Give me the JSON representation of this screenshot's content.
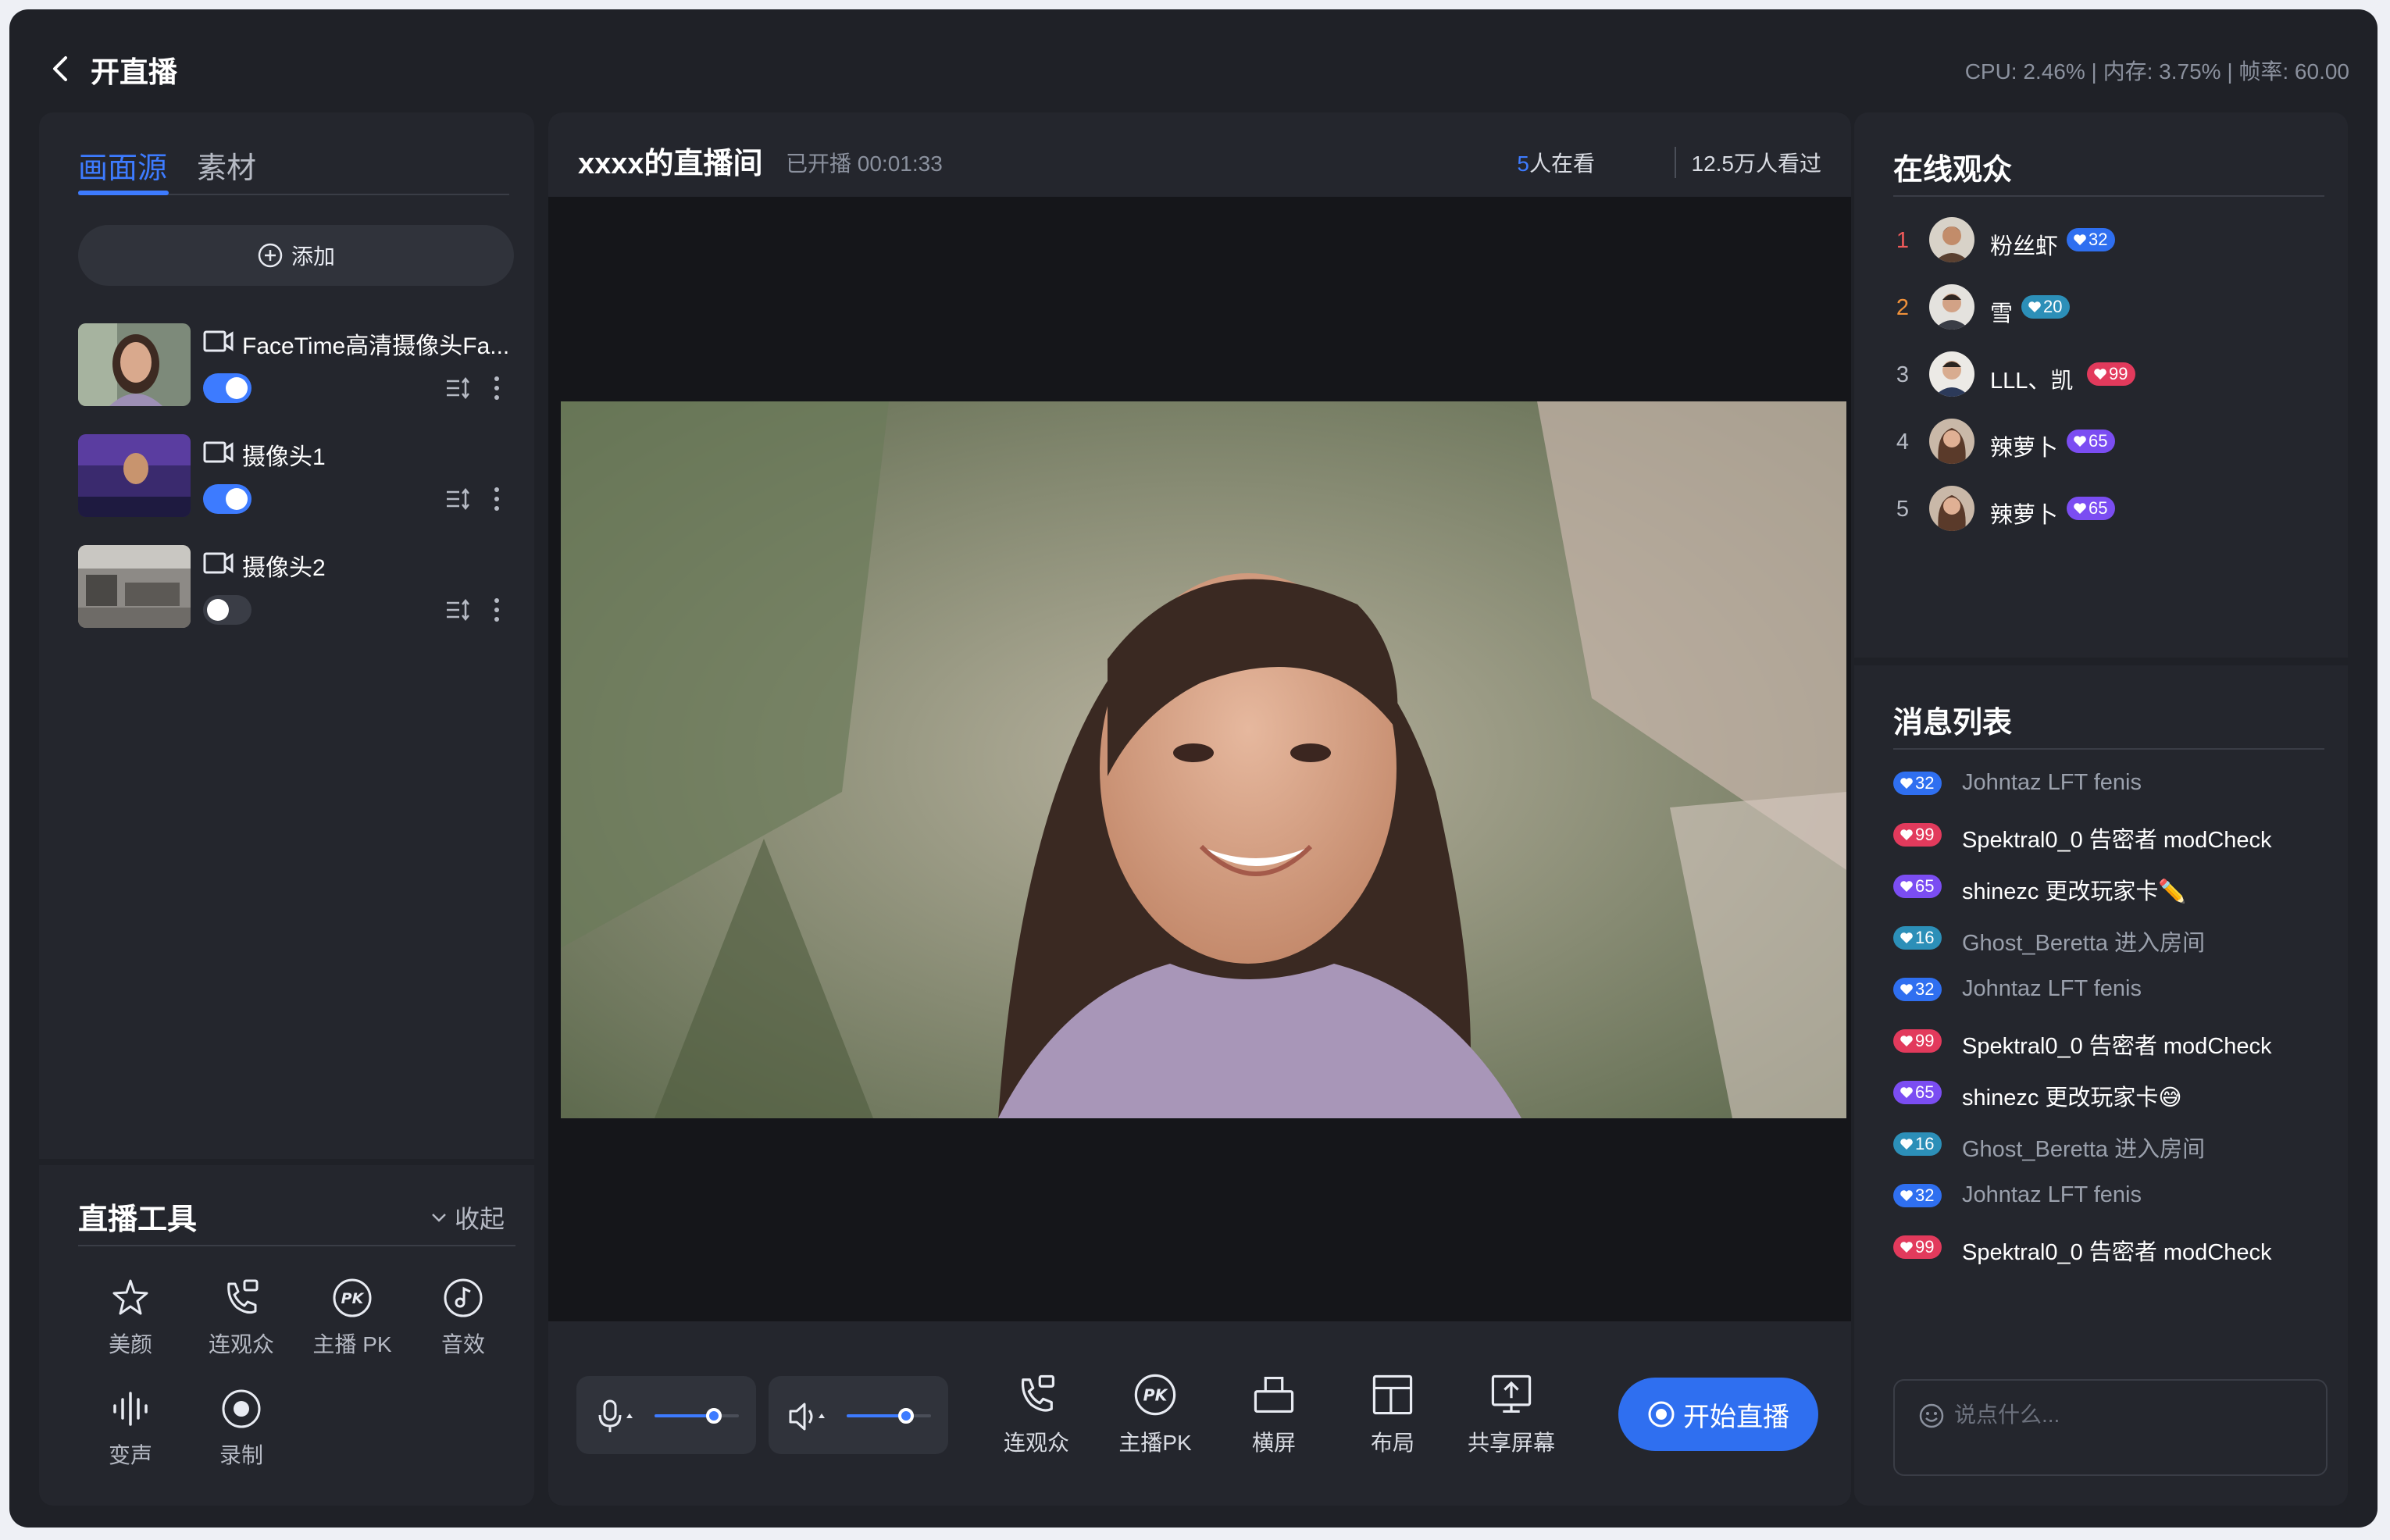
{
  "header": {
    "title": "开直播",
    "stats": "CPU: 2.46% | 内存: 3.75% | 帧率: 60.00"
  },
  "sources_panel": {
    "tabs": [
      {
        "label": "画面源",
        "active": true
      },
      {
        "label": "素材",
        "active": false
      }
    ],
    "add_label": "添加",
    "items": [
      {
        "name": "FaceTime高清摄像头Fa...",
        "enabled": true
      },
      {
        "name": "摄像头1",
        "enabled": true
      },
      {
        "name": "摄像头2",
        "enabled": false
      }
    ]
  },
  "tools_panel": {
    "title": "直播工具",
    "collapse_label": "收起",
    "tools": [
      {
        "label": "美颜",
        "icon": "beauty-icon"
      },
      {
        "label": "连观众",
        "icon": "call-audience-icon"
      },
      {
        "label": "主播 PK",
        "icon": "pk-icon"
      },
      {
        "label": "音效",
        "icon": "music-note-icon"
      },
      {
        "label": "变声",
        "icon": "voice-wave-icon"
      },
      {
        "label": "录制",
        "icon": "record-icon"
      }
    ]
  },
  "stream": {
    "title": "xxxx的直播间",
    "status": "已开播 00:01:33",
    "watching_count": "5",
    "watching_suffix": "人在看",
    "viewed": "12.5万人看过"
  },
  "controls": {
    "mic_level": 0.7,
    "speaker_level": 0.7,
    "buttons": [
      {
        "label": "连观众",
        "icon": "call-audience-icon"
      },
      {
        "label": "主播PK",
        "icon": "pk-icon"
      },
      {
        "label": "横屏",
        "icon": "landscape-icon"
      },
      {
        "label": "布局",
        "icon": "layout-icon"
      },
      {
        "label": "共享屏幕",
        "icon": "share-screen-icon"
      }
    ],
    "start_label": "开始直播"
  },
  "audience": {
    "title": "在线观众",
    "items": [
      {
        "rank": "1",
        "name": "粉丝虾",
        "badge": "32",
        "badge_color": "#2f6ff0"
      },
      {
        "rank": "2",
        "name": "雪",
        "badge": "20",
        "badge_color": "#1e8fc0"
      },
      {
        "rank": "3",
        "name": "LLL、凯",
        "badge": "99",
        "badge_color": "#e23a5c"
      },
      {
        "rank": "4",
        "name": "辣萝卜",
        "badge": "65",
        "badge_color": "#7b4df2"
      },
      {
        "rank": "5",
        "name": "辣萝卜",
        "badge": "65",
        "badge_color": "#7b4df2"
      }
    ]
  },
  "messages": {
    "title": "消息列表",
    "items": [
      {
        "badge": "32",
        "user": "Johntaz",
        "text": "LFT fenis"
      },
      {
        "badge": "99",
        "user": "Spektral0_0",
        "text": "告密者 modCheck"
      },
      {
        "badge": "65",
        "user": "shinezc",
        "text": "更改玩家卡✏️"
      },
      {
        "badge": "16",
        "user": "Ghost_Beretta",
        "text": "进入房间"
      },
      {
        "badge": "32",
        "user": "Johntaz",
        "text": "LFT fenis"
      },
      {
        "badge": "99",
        "user": "Spektral0_0",
        "text": "告密者 modCheck"
      },
      {
        "badge": "65",
        "user": "shinezc",
        "text": "更改玩家卡😅"
      },
      {
        "badge": "16",
        "user": "Ghost_Beretta",
        "text": "进入房间"
      },
      {
        "badge": "32",
        "user": "Johntaz",
        "text": "LFT fenis"
      },
      {
        "badge": "99",
        "user": "Spektral0_0",
        "text": "告密者 modCheck"
      }
    ],
    "input_placeholder": "说点什么..."
  }
}
